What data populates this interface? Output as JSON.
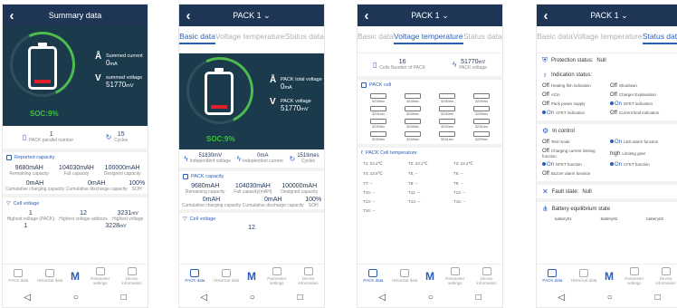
{
  "screen1": {
    "title": "Summary data",
    "current_label": "Summed current",
    "current_value": "0",
    "current_unit": "mA",
    "voltage_label": "summed voltage",
    "voltage_value": "51770",
    "voltage_unit": "mV",
    "soc": "SOC:9%",
    "parallel_value": "1",
    "parallel_label": "PACK parallel number",
    "cycles_value": "15",
    "cycles_label": "Cycles",
    "reported_title": "Reported capacity",
    "cap_row1": [
      {
        "value": "9680mAH",
        "label": "Remaining capacity"
      },
      {
        "value": "104030mAH",
        "label": "Full capacity"
      },
      {
        "value": "100000mAH",
        "label": "Designed capacity"
      }
    ],
    "cap_row2": [
      {
        "value": "0mAH",
        "label": "Cumulative charging capacity"
      },
      {
        "value": "0mAH",
        "label": "Cumulative discharge capacity"
      },
      {
        "value": "100%",
        "label": "SOH"
      }
    ],
    "cell_voltage_title": "Cell voltage",
    "cv_row": [
      {
        "value": "1",
        "label": "Highest voltage (PACK)"
      },
      {
        "value": "12",
        "label": "Highest voltage address"
      },
      {
        "value": "3231",
        "unit": "mV",
        "label": "Highest voltage"
      }
    ],
    "cv_row2_a": "1",
    "cv_row2_c": "3228",
    "cv_row2_c_unit": "mV"
  },
  "screen2": {
    "title": "PACK 1",
    "tabs": [
      "Basic data",
      "Voltage temperature",
      "Status data"
    ],
    "total_voltage_label": "PACK total voltage",
    "current_value": "0",
    "current_unit": "mA",
    "pack_voltage_label": "PACK voltage",
    "pack_voltage_value": "51770",
    "pack_voltage_unit": "mV",
    "soc": "SOC:9%",
    "ind_voltage_value": "51830mV",
    "ind_voltage_label": "Independent voltage",
    "ind_current_value": "0mA",
    "ind_current_label": "Independent current",
    "cycles_value": "151times",
    "cycles_label": "Cycles",
    "capacity_title": "PACK capacity",
    "cap_row1": [
      {
        "value": "9680mAH",
        "label": "Remaining capacity"
      },
      {
        "value": "104030mAH",
        "label": "Full capacity(mAH)"
      },
      {
        "value": "100000mAH",
        "label": "Designed capacity"
      }
    ],
    "cap_row2": [
      {
        "value": "0mAH",
        "label": "Cumulative charging capacity"
      },
      {
        "value": "0mAH",
        "label": "Cumulative discharge capacity"
      },
      {
        "value": "100%",
        "label": "SOH"
      }
    ],
    "cell_voltage_title": "Cell voltage",
    "cell_voltage_partial": "12"
  },
  "screen3": {
    "title": "PACK 1",
    "tabs": [
      "Basic data",
      "Voltage temperature",
      "Status data"
    ],
    "cells_number": "16",
    "cells_number_label": "Cells Number of PACK",
    "pack_voltage_value": "51770",
    "pack_voltage_unit": "mV",
    "pack_voltage_label": "PACK voltage",
    "pack_cell_title": "PACK cell",
    "cells": [
      "3228mv",
      "3228mv",
      "3230mv",
      "3229mv",
      "3231mv",
      "3228mv",
      "3230mv",
      "3229mv",
      "3230mv",
      "3228mv",
      "3229mv",
      "3231mv",
      "3230mv",
      "3228mv",
      "3231mv",
      "3229mv"
    ],
    "temp_title": "PACK Cell temperature",
    "temps": [
      "T1: 23.4℃",
      "T2: 23.1℃",
      "T3: 23.4℃",
      "T4: 23.5℃",
      "T5: --",
      "T6: --",
      "T7: --",
      "T8: --",
      "T9: --",
      "T10: --",
      "T11: --",
      "T12: --",
      "T13: --",
      "T14: --",
      "T15: --",
      "T16: --"
    ]
  },
  "screen4": {
    "title": "PACK 1",
    "tabs": [
      "Basic data",
      "Voltage temperature",
      "Status data"
    ],
    "protection_label": "Protection status:",
    "protection_value": "Null",
    "indication_label": "Indication status:",
    "indication_items": [
      {
        "state": "Off",
        "label": "Heating film indication"
      },
      {
        "state": "Off",
        "label": "Shutdown"
      },
      {
        "state": "Off",
        "label": "ACin"
      },
      {
        "state": "Off",
        "label": "Charger Explanation"
      },
      {
        "state": "Off",
        "label": "Pack power supply"
      },
      {
        "state": "On",
        "label": "DFET indication"
      },
      {
        "state": "On",
        "label": "CFET indication"
      },
      {
        "state": "Off",
        "label": "Current limit indication"
      }
    ],
    "control_label": "In control",
    "control_items": [
      {
        "state": "Off",
        "label": "Test mode"
      },
      {
        "state": "On",
        "label": "LED alarm function"
      },
      {
        "state": "Off",
        "label": "Charging current limiting function"
      },
      {
        "state": "high",
        "label": "Limiting gear"
      },
      {
        "state": "On",
        "label": "DFET function"
      },
      {
        "state": "On",
        "label": "CFET function"
      },
      {
        "state": "Off",
        "label": "Buzzer alarm function"
      }
    ],
    "fault_label": "Fault state:",
    "fault_value": "Null",
    "equilibrium_label": "Battery equilibrium state",
    "batteries": [
      "battery01",
      "battery02",
      "battery03"
    ]
  },
  "nav": {
    "items": [
      "PACK data",
      "Historical data",
      "Parameter settings",
      "Device information"
    ],
    "logo": "M"
  },
  "sysnav": {
    "back": "◁",
    "home": "○",
    "recent": "□"
  }
}
